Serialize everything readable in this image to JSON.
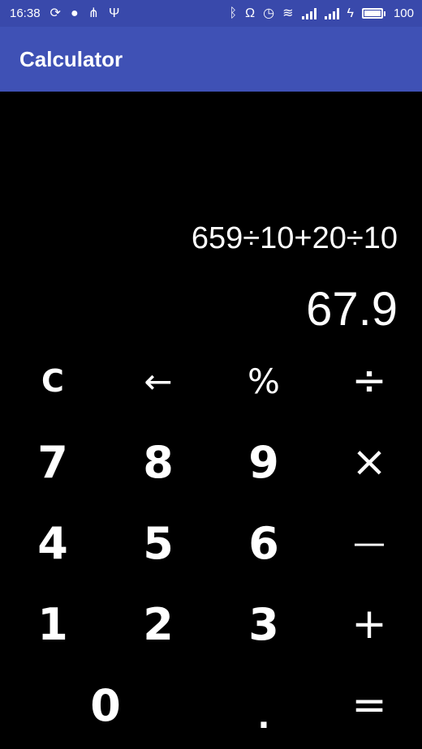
{
  "status_bar": {
    "time": "16:38",
    "battery_label": "100",
    "battery_level_percent": 100,
    "left_icons": [
      "sync-icon",
      "chat-icon",
      "share-icon",
      "usb-icon"
    ],
    "right_icons": [
      "bluetooth-icon",
      "headset-icon",
      "alarm-icon",
      "wifi-icon",
      "signal-icon",
      "signal-4g-icon",
      "charging-icon",
      "battery-icon"
    ]
  },
  "app_bar": {
    "title": "Calculator"
  },
  "display": {
    "expression": "659÷10+20÷10",
    "result": "67.9"
  },
  "keypad": {
    "clear": "C",
    "backspace": "←",
    "percent": "%",
    "divide": "÷",
    "seven": "7",
    "eight": "8",
    "nine": "9",
    "multiply": "×",
    "four": "4",
    "five": "5",
    "six": "6",
    "subtract": "—",
    "one": "1",
    "two": "2",
    "three": "3",
    "add": "+",
    "zero": "0",
    "decimal": ".",
    "equals": "="
  },
  "colors": {
    "status_bar": "#3949ab",
    "app_bar": "#3f51b5",
    "background": "#000000",
    "text": "#ffffff"
  }
}
